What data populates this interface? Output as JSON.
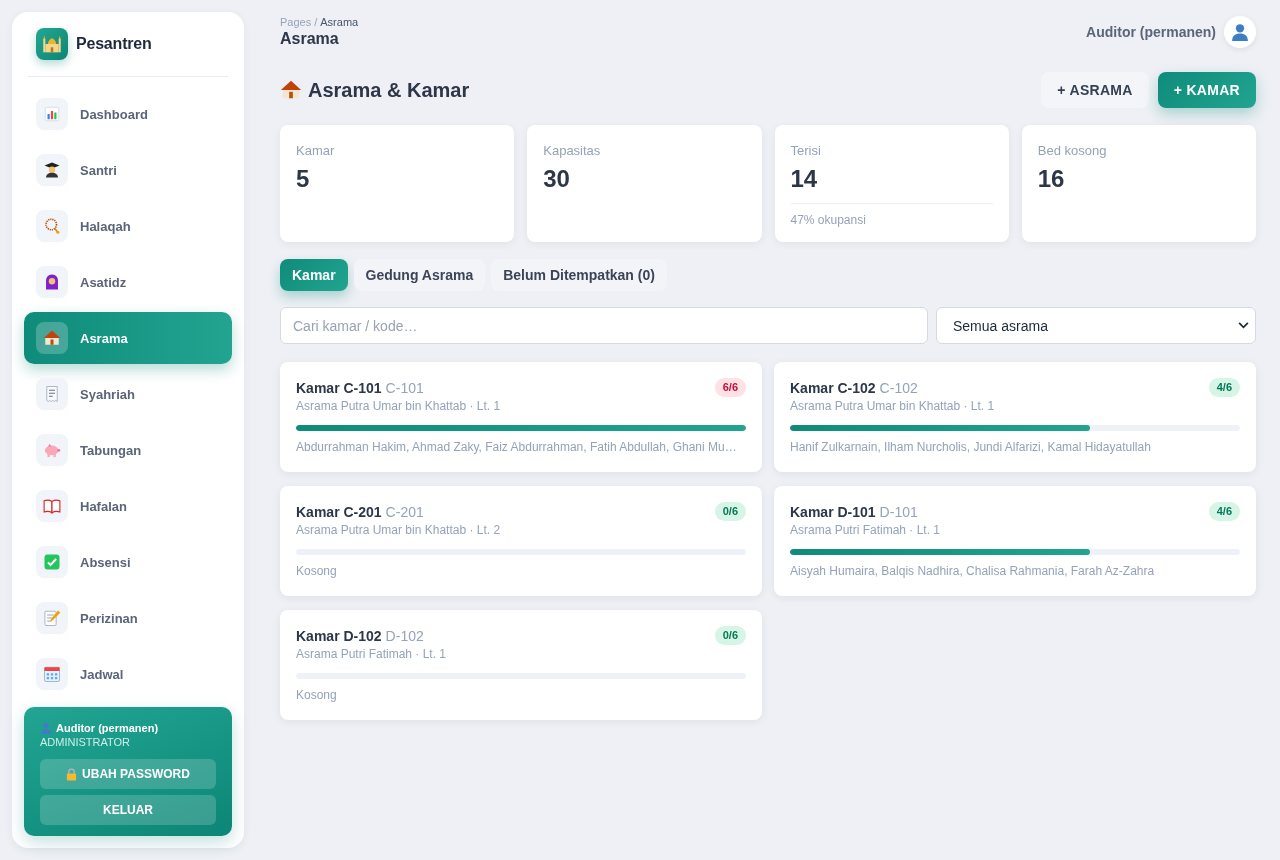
{
  "sidebar": {
    "brand": "Pesantren",
    "items": [
      {
        "label": "Dashboard",
        "selected": false
      },
      {
        "label": "Santri",
        "selected": false
      },
      {
        "label": "Halaqah",
        "selected": false
      },
      {
        "label": "Asatidz",
        "selected": false
      },
      {
        "label": "Asrama",
        "selected": true
      },
      {
        "label": "Syahriah",
        "selected": false
      },
      {
        "label": "Tabungan",
        "selected": false
      },
      {
        "label": "Hafalan",
        "selected": false
      },
      {
        "label": "Absensi",
        "selected": false
      },
      {
        "label": "Perizinan",
        "selected": false
      },
      {
        "label": "Jadwal",
        "selected": false
      }
    ],
    "user": {
      "name": "Auditor (permanen)",
      "role": "ADMINISTRATOR",
      "buttons": [
        {
          "label": "UBAH PASSWORD",
          "kind": "password"
        },
        {
          "label": "KELUAR",
          "kind": "logout"
        }
      ]
    }
  },
  "header": {
    "breadcrumb": {
      "items": [
        "Pages",
        "Asrama"
      ],
      "separator": "/"
    },
    "title": "Asrama",
    "user_name": "Auditor (permanen)"
  },
  "page": {
    "title": "Asrama & Kamar",
    "buttons": [
      {
        "label": "+ ASRAMA",
        "kind": "secondary"
      },
      {
        "label": "+ KAMAR",
        "kind": "primary"
      }
    ]
  },
  "stats": [
    {
      "label": "Kamar",
      "value": "5"
    },
    {
      "label": "Kapasitas",
      "value": "30"
    },
    {
      "label": "Terisi",
      "value": "14",
      "note": "47% okupansi"
    },
    {
      "label": "Bed kosong",
      "value": "16"
    }
  ],
  "tabs": [
    {
      "label": "Kamar",
      "selected": true
    },
    {
      "label": "Gedung Asrama",
      "selected": false
    },
    {
      "label": "Belum Ditempatkan (0)",
      "selected": false
    }
  ],
  "filters": {
    "search": {
      "placeholder": "Cari kamar / kode…"
    },
    "asrama": {
      "value": "Semua asrama"
    }
  },
  "rooms": [
    {
      "name": "Kamar C-101",
      "code": "C-101",
      "building": "Asrama Putra Umar bin Khattab · Lt. 1",
      "badge": "6/6",
      "full": true,
      "level": 1,
      "occupants": "Abdurrahman Hakim, Ahmad Zaky, Faiz Abdurrahman, Fatih Abdullah, Ghani Mu…"
    },
    {
      "name": "Kamar C-102",
      "code": "C-102",
      "building": "Asrama Putra Umar bin Khattab · Lt. 1",
      "badge": "4/6",
      "full": false,
      "level": 0.667,
      "occupants": "Hanif Zulkarnain, Ilham Nurcholis, Jundi Alfarizi, Kamal Hidayatullah"
    },
    {
      "name": "Kamar C-201",
      "code": "C-201",
      "building": "Asrama Putra Umar bin Khattab · Lt. 2",
      "badge": "0/6",
      "full": false,
      "level": 0,
      "occupants": "Kosong"
    },
    {
      "name": "Kamar D-101",
      "code": "D-101",
      "building": "Asrama Putri Fatimah · Lt. 1",
      "badge": "4/6",
      "full": false,
      "level": 0.667,
      "occupants": "Aisyah Humaira, Balqis Nadhira, Chalisa Rahmania, Farah Az-Zahra"
    },
    {
      "name": "Kamar D-102",
      "code": "D-102",
      "building": "Asrama Putri Fatimah · Lt. 1",
      "badge": "0/6",
      "full": false,
      "level": 0,
      "occupants": "Kosong"
    }
  ]
}
